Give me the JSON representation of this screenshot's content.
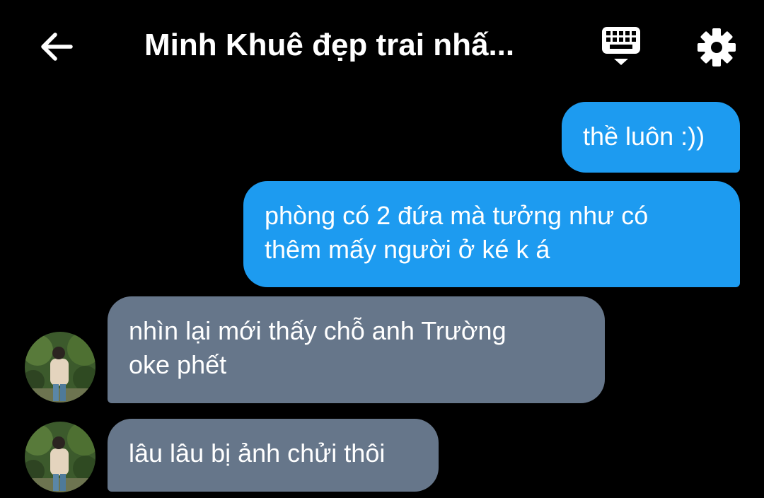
{
  "header": {
    "title": "Minh Khuê đẹp trai nhấ...",
    "back_icon": "arrow-left-icon",
    "keyboard_icon": "keyboard-icon",
    "settings_icon": "gear-icon"
  },
  "messages": [
    {
      "direction": "outgoing",
      "lines": [
        "thề luôn :))"
      ]
    },
    {
      "direction": "outgoing",
      "lines": [
        "phòng có 2 đứa mà tưởng như có",
        "thêm mấy người ở ké k á"
      ]
    },
    {
      "direction": "incoming",
      "lines": [
        "nhìn lại mới thấy chỗ anh Trường",
        "oke phết"
      ]
    },
    {
      "direction": "incoming",
      "lines": [
        "lâu lâu bị ảnh chửi thôi"
      ]
    }
  ],
  "colors": {
    "background": "#000000",
    "outgoing_bubble": "#1d9bf0",
    "incoming_bubble": "#66768a",
    "text": "#ffffff"
  }
}
